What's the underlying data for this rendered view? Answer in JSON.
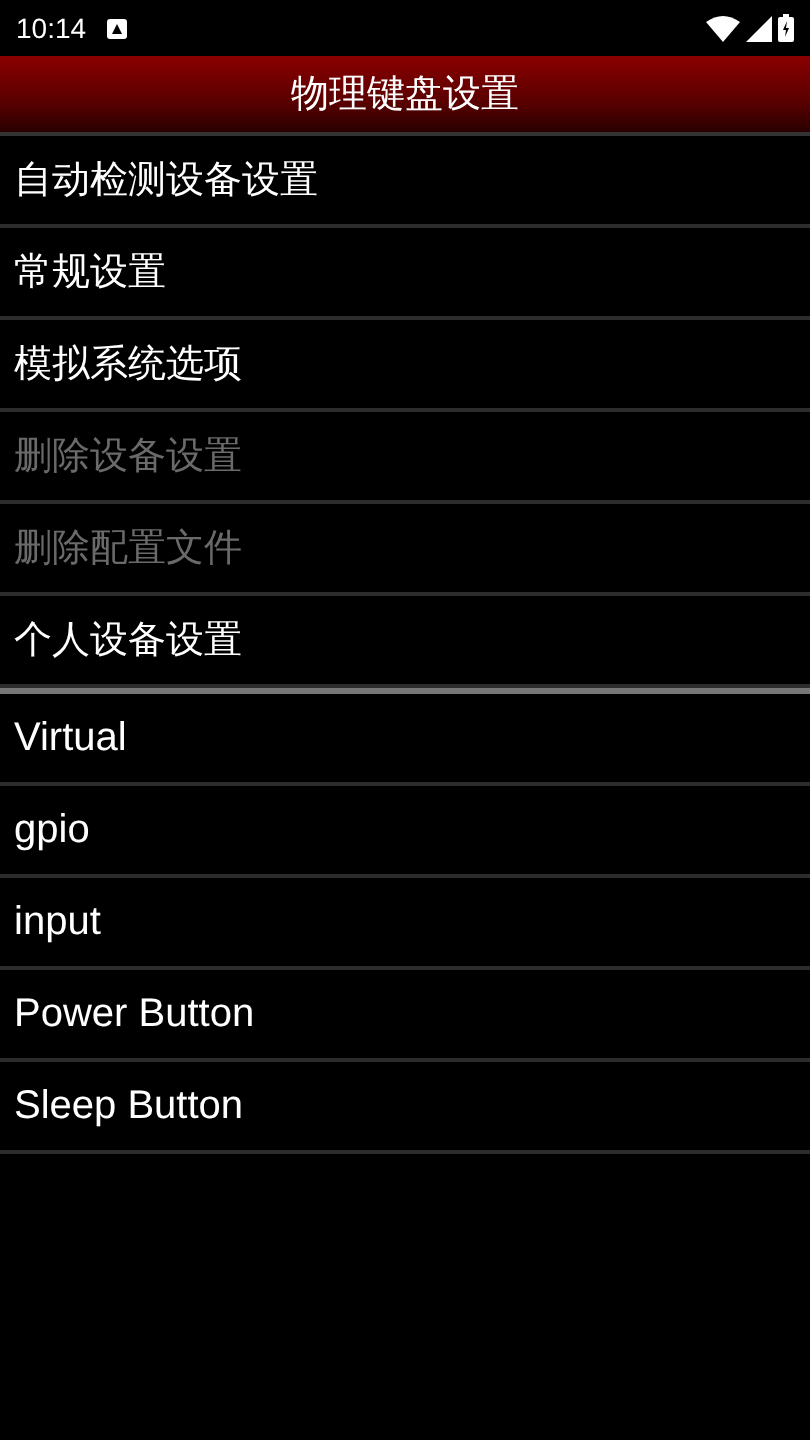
{
  "status_bar": {
    "time": "10:14"
  },
  "title": "物理键盘设置",
  "settings": [
    {
      "label": "自动检测设备设置",
      "disabled": false
    },
    {
      "label": "常规设置",
      "disabled": false
    },
    {
      "label": "模拟系统选项",
      "disabled": false
    },
    {
      "label": "删除设备设置",
      "disabled": true
    },
    {
      "label": "删除配置文件",
      "disabled": true
    },
    {
      "label": "个人设备设置",
      "disabled": false
    }
  ],
  "devices": [
    {
      "label": "Virtual"
    },
    {
      "label": "gpio"
    },
    {
      "label": "input"
    },
    {
      "label": "Power Button"
    },
    {
      "label": "Sleep Button"
    }
  ]
}
